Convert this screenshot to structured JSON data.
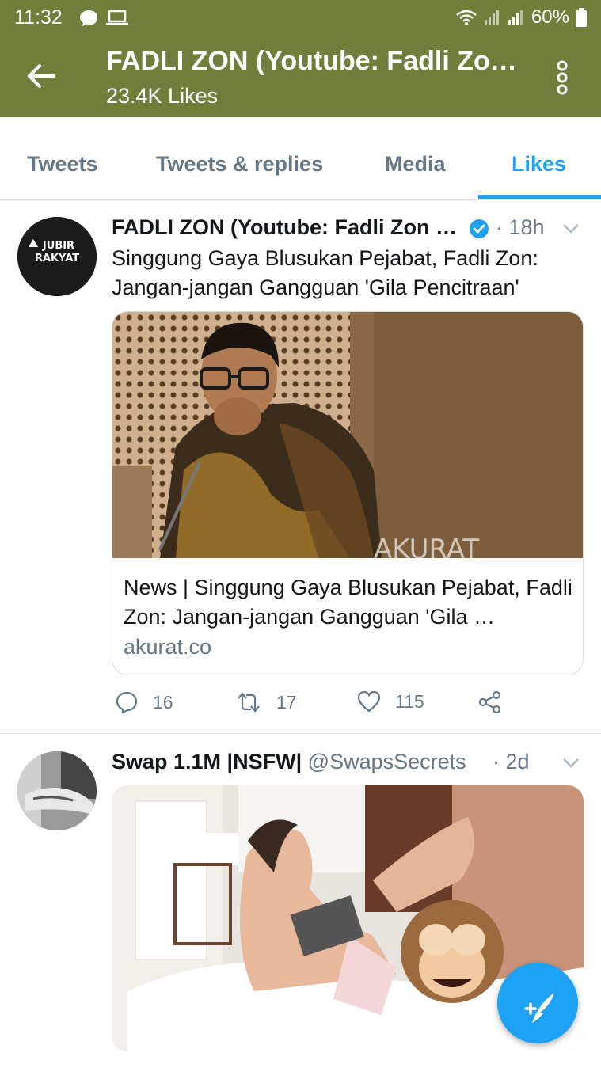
{
  "status_bar": {
    "time": "11:32",
    "battery": "60%"
  },
  "header": {
    "title": "FADLI ZON (Youtube: Fadli Zo…",
    "subtitle": "23.4K Likes"
  },
  "tabs": [
    {
      "label": "Tweets",
      "active": false
    },
    {
      "label": "Tweets & replies",
      "active": false
    },
    {
      "label": "Media",
      "active": false
    },
    {
      "label": "Likes",
      "active": true
    }
  ],
  "tweets": [
    {
      "avatar_text": [
        "JUBIR",
        "RAKYAT"
      ],
      "name": "FADLI ZON (Youtube: Fadli Zon …",
      "handle": "",
      "time": "· 18h",
      "verified": true,
      "text": "Singgung Gaya Blusukan Pejabat, Fadli Zon: Jangan-jangan Gangguan 'Gila Pencitraan'",
      "card": {
        "title": "News | Singgung Gaya Blusukan Pejabat, Fadli Zon: Jangan-jangan Gangguan 'Gila …",
        "domain": "akurat.co",
        "watermark": "AKURAT"
      },
      "stats": {
        "replies": "16",
        "retweets": "17",
        "likes": "115"
      }
    },
    {
      "name": "Swap 1.1M |NSFW|",
      "handle": "@SwapsSecrets",
      "time": "· 2d",
      "verified": false
    }
  ],
  "colors": {
    "header_bg": "#6f7f3b",
    "accent": "#1da1f2",
    "muted": "#657786"
  }
}
